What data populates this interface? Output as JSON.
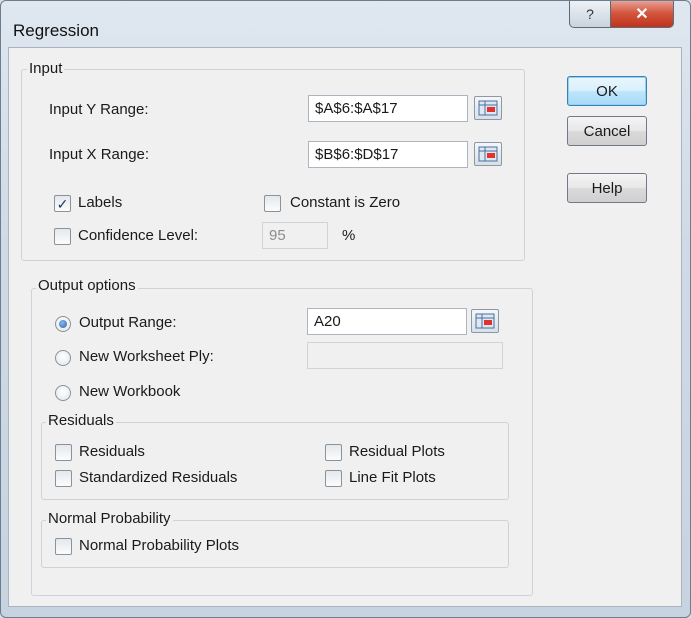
{
  "window": {
    "title": "Regression",
    "help_glyph": "?",
    "close_glyph": "✕"
  },
  "buttons": {
    "ok": "OK",
    "cancel": "Cancel",
    "help": "Help"
  },
  "input": {
    "group_title": "Input",
    "y_range_label": "Input Y Range:",
    "y_range_value": "$A$6:$A$17",
    "x_range_label": "Input X Range:",
    "x_range_value": "$B$6:$D$17",
    "labels": {
      "label": "Labels",
      "checked": true
    },
    "constant_zero": {
      "label": "Constant is Zero",
      "checked": false
    },
    "confidence": {
      "label": "Confidence Level:",
      "checked": false,
      "value": "95",
      "unit": "%"
    }
  },
  "output": {
    "group_title": "Output options",
    "output_range": {
      "label": "Output Range:",
      "selected": true,
      "value": "A20"
    },
    "new_ply": {
      "label": "New Worksheet Ply:",
      "selected": false,
      "value": ""
    },
    "new_workbook": {
      "label": "New Workbook",
      "selected": false
    }
  },
  "residuals": {
    "group_title": "Residuals",
    "residuals": {
      "label": "Residuals",
      "checked": false
    },
    "standardized": {
      "label": "Standardized Residuals",
      "checked": false
    },
    "residual_plots": {
      "label": "Residual Plots",
      "checked": false
    },
    "line_fit_plots": {
      "label": "Line Fit Plots",
      "checked": false
    }
  },
  "normal_probability": {
    "group_title": "Normal Probability",
    "plots": {
      "label": "Normal Probability Plots",
      "checked": false
    }
  },
  "colors": {
    "close_button": "#c0321b",
    "radio_selected": "#2a63b0",
    "default_button_border": "#3c7fb1"
  },
  "icons": {
    "range_selector": "range-selector-icon",
    "check": "checkmark-icon"
  }
}
